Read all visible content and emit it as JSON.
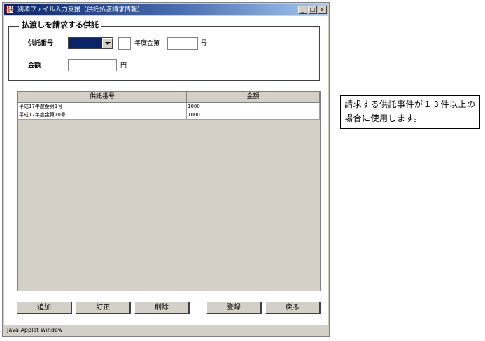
{
  "window": {
    "title": "別添ファイル入力支援（供託払渡請求情報）",
    "app_icon_glyph": "供",
    "controls": {
      "minimize": "_",
      "maximize": "□",
      "close": "×"
    }
  },
  "group": {
    "legend": "払渡しを請求する供託",
    "deposit_number_label": "供託番号",
    "era_selected": "",
    "year_value": "",
    "year_suffix": "年度金第",
    "number_value": "",
    "number_suffix": "号",
    "amount_label": "金額",
    "amount_value": "",
    "amount_unit": "円"
  },
  "table": {
    "columns": [
      "供託番号",
      "金額"
    ],
    "rows": [
      {
        "number": "平成17年度金第1号",
        "amount": "1000"
      },
      {
        "number": "平成17年度金第10号",
        "amount": "1000"
      }
    ]
  },
  "buttons": {
    "add": "追加",
    "correct": "訂正",
    "delete": "削除",
    "register": "登録",
    "back": "戻る"
  },
  "status": {
    "text": "Java Applet Window"
  },
  "note": {
    "text": "請求する供託事件が１３件以上の場合に使用します。"
  },
  "colors": {
    "title_start": "#0a246a",
    "title_end": "#a6caf0",
    "combo_selected": "#0a246a",
    "window_face": "#d4d0c8"
  }
}
